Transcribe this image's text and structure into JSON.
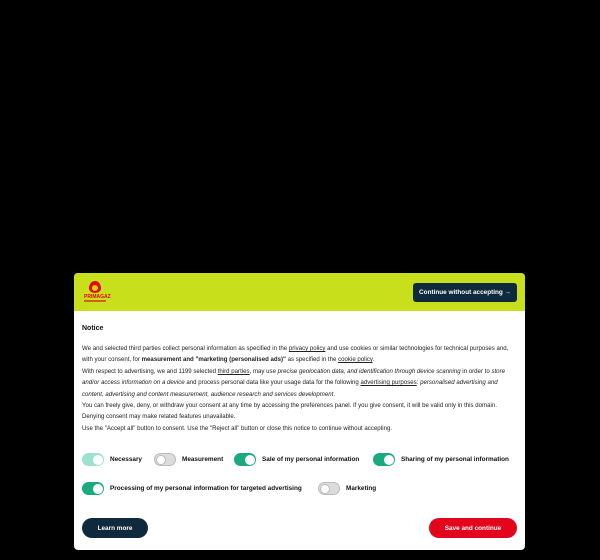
{
  "logo": {
    "brand": "PRIMAGAZ"
  },
  "header": {
    "continue_label": "Continue without accepting →"
  },
  "notice": {
    "title": "Notice",
    "p1": {
      "a": "We and selected third parties collect personal information as specified in the ",
      "link_privacy": "privacy policy",
      "b": " and use cookies or similar technologies for technical purposes and, with your consent, for ",
      "bold": "measurement and \"marketing (personalised ads)\"",
      "c": " as specified in the ",
      "link_cookie": "cookie policy",
      "d": "."
    },
    "p2": {
      "a": "With respect to advertising, we and 1199 selected ",
      "link_third": "third parties",
      "b": ", may use ",
      "i1": "precise geolocation data, and identification through device scanning",
      "c": " in order to ",
      "i2": "store and/or access information on a device",
      "d": " and process personal data like your usage data for the following ",
      "link_purposes": "advertising purposes",
      "e": ": ",
      "i3": "personalised advertising and content, advertising and content measurement, audience research and services development",
      "f": "."
    },
    "p3": "You can freely give, deny, or withdraw your consent at any time by accessing the preferences panel. If you give consent, it will be valid only in this domain. Denying consent may make related features unavailable.",
    "p4": "Use the \"Accept all\" button to consent. Use the \"Reject all\" button or close this notice to continue without accepting."
  },
  "toggles": [
    {
      "label": "Necessary",
      "state": "on-locked"
    },
    {
      "label": "Measurement",
      "state": "off"
    },
    {
      "label": "Sale of my personal information",
      "state": "on"
    },
    {
      "label": "Sharing of my personal information",
      "state": "on"
    },
    {
      "label": "Processing of my personal information for targeted advertising",
      "state": "on"
    },
    {
      "label": "Marketing",
      "state": "off"
    }
  ],
  "footer": {
    "learn_more": "Learn more",
    "save": "Save and continue"
  },
  "colors": {
    "header_bg": "#c8df1c",
    "dark_button": "#0f2a3c",
    "save_button": "#e3051b",
    "toggle_on": "#1aaa80"
  }
}
